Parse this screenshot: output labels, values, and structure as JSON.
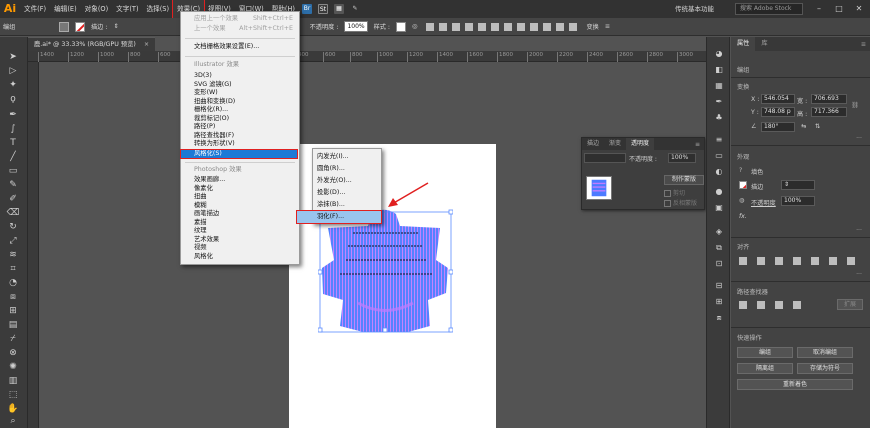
{
  "app": {
    "logo": "Ai",
    "workspace": "传统基本功能",
    "search_placeholder": "搜索 Adobe Stock"
  },
  "menubar": {
    "items": [
      "文件(F)",
      "编辑(E)",
      "对象(O)",
      "文字(T)",
      "选择(S)",
      "效果(C)",
      "视图(V)",
      "窗口(W)",
      "帮助(H)"
    ],
    "active_index": 5,
    "icons": [
      "Br",
      "St"
    ]
  },
  "controlbar": {
    "selection": "编组",
    "stroke_label": "描边 :",
    "opacity_label": "不透明度 :",
    "opacity_value": "100%",
    "style_label": "样式 :",
    "transform_label": "变换"
  },
  "document": {
    "tab_title": "鹿.ai* @ 33.33% (RGB/GPU 预览)",
    "close": "×"
  },
  "ruler": {
    "ticks": [
      "1400",
      "1200",
      "1000",
      "800",
      "600",
      "400",
      "200",
      "0",
      "200",
      "400",
      "600",
      "800",
      "1000",
      "1200",
      "1400",
      "1600",
      "1800",
      "2000",
      "2200",
      "2400",
      "2600",
      "2800",
      "3000",
      "3200",
      "3400"
    ]
  },
  "effect_menu": {
    "apply_last": "应用上一个效果",
    "apply_last_shortcut": "Shift+Ctrl+E",
    "last_effect": "上一个效果",
    "last_effect_shortcut": "Alt+Shift+Ctrl+E",
    "raster_settings": "文档栅格效果设置(E)...",
    "illustrator_header": "Illustrator 效果",
    "illustrator_items": [
      "3D(3)",
      "SVG 滤镜(G)",
      "变形(W)",
      "扭曲和变换(D)",
      "栅格化(R)...",
      "裁剪标记(O)",
      "路径(P)",
      "路径查找器(F)",
      "转换为形状(V)",
      "风格化(S)"
    ],
    "highlighted": "风格化(S)",
    "photoshop_header": "Photoshop 效果",
    "photoshop_items": [
      "效果画廊...",
      "像素化",
      "扭曲",
      "模糊",
      "画笔描边",
      "素描",
      "纹理",
      "艺术效果",
      "视频",
      "风格化"
    ]
  },
  "stylize_submenu": {
    "items": [
      "内发光(I)...",
      "圆角(R)...",
      "外发光(O)...",
      "投影(D)...",
      "涂抹(B)...",
      "羽化(F)..."
    ],
    "highlighted": "羽化(F)..."
  },
  "transparency_panel": {
    "tabs": [
      "描边",
      "渐变",
      "透明度"
    ],
    "active_tab": "透明度",
    "mode": "",
    "opacity_label": "不透明度 :",
    "opacity_value": "100%",
    "make_mask": "制作蒙版",
    "clip": "剪切",
    "invert": "反相蒙版"
  },
  "properties": {
    "tabs": [
      "属性",
      "库"
    ],
    "active_tab": "属性",
    "group_label": "编组",
    "transform_label": "变换",
    "x_key": "X :",
    "x_value": "546.054",
    "y_key": "Y :",
    "y_value": "748.08 p",
    "w_key": "宽 :",
    "w_value": "706.693",
    "h_key": "高 :",
    "h_value": "717.366",
    "angle_value": "180°",
    "appearance_label": "外观",
    "fill_label": "填色",
    "stroke_label": "描边",
    "opacity_label": "不透明度",
    "opacity_value": "100%",
    "fx": "fx.",
    "align_label": "对齐",
    "pathfinder_label": "路径查找器",
    "pathfinder_expand": "扩展",
    "quick_actions_label": "快速操作",
    "buttons": [
      "编组",
      "取消编组",
      "隔离组",
      "存储为符号",
      "重新着色"
    ]
  },
  "colors": {
    "accent_red": "#e02020",
    "menu_highlight": "#1d7ad6",
    "art_blue": "#4c7bff",
    "art_purple": "#c07cff"
  }
}
